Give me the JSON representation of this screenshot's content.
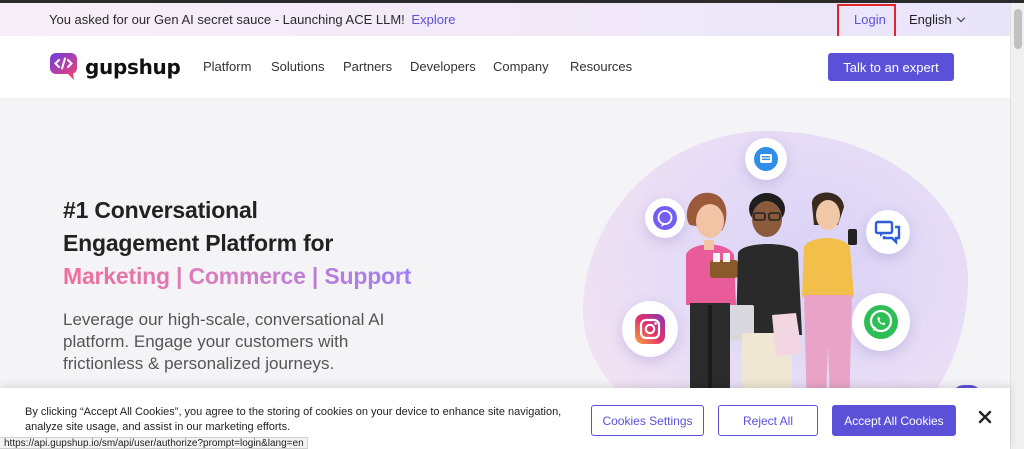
{
  "announcement": {
    "text": "You asked for our Gen AI secret sauce - Launching ACE LLM!",
    "link": "Explore"
  },
  "utility": {
    "login": "Login",
    "language": "English"
  },
  "brand": {
    "name": "gupshup",
    "accent": "#5b50d8"
  },
  "nav": {
    "items": [
      {
        "label": "Platform"
      },
      {
        "label": "Solutions"
      },
      {
        "label": "Partners"
      },
      {
        "label": "Developers"
      },
      {
        "label": "Company"
      },
      {
        "label": "Resources"
      }
    ],
    "cta": "Talk to an expert"
  },
  "hero": {
    "headline_1": "#1 Conversational",
    "headline_2": "Engagement Platform for",
    "headline_3": "Marketing | Commerce | Support",
    "subtext_1": "Leverage our high-scale, conversational AI",
    "subtext_2": "platform. Engage your customers with",
    "subtext_3": "frictionless & personalized journeys.",
    "channel_icons": [
      "message-icon",
      "viber-icon",
      "chat-bubbles-icon",
      "instagram-icon",
      "whatsapp-icon"
    ]
  },
  "cookie": {
    "text": "By clicking “Accept All Cookies”, you agree to the storing of cookies on your device to enhance site navigation, analyze site usage, and assist in our marketing efforts.",
    "settings": "Cookies Settings",
    "reject": "Reject All",
    "accept": "Accept All Cookies"
  },
  "status_url": "https://api.gupshup.io/sm/api/user/authorize?prompt=login&lang=en"
}
